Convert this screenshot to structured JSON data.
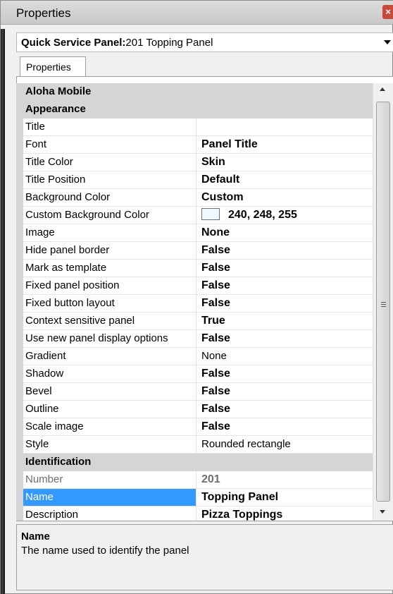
{
  "window": {
    "title": "Properties",
    "close_glyph": "×"
  },
  "selector": {
    "type_label": "Quick Service Panel:",
    "value": "201 Topping Panel"
  },
  "tabs": [
    {
      "label": "Properties"
    }
  ],
  "grid": {
    "categories": {
      "aloha_mobile": "Aloha Mobile",
      "appearance": "Appearance",
      "identification": "Identification"
    },
    "appearance_rows": [
      {
        "name": "Title",
        "value": ""
      },
      {
        "name": "Font",
        "value": "Panel Title"
      },
      {
        "name": "Title Color",
        "value": "Skin"
      },
      {
        "name": "Title Position",
        "value": "Default"
      },
      {
        "name": "Background Color",
        "value": "Custom"
      },
      {
        "name": "Custom Background Color",
        "value": "240, 248, 255"
      },
      {
        "name": "Image",
        "value": "None"
      },
      {
        "name": "Hide panel border",
        "value": "False"
      },
      {
        "name": "Mark as template",
        "value": "False"
      },
      {
        "name": "Fixed panel position",
        "value": "False"
      },
      {
        "name": "Fixed button layout",
        "value": "False"
      },
      {
        "name": "Context sensitive panel",
        "value": "True"
      },
      {
        "name": "Use new panel display options",
        "value": "False"
      },
      {
        "name": "Gradient",
        "value": "None"
      },
      {
        "name": "Shadow",
        "value": "False"
      },
      {
        "name": "Bevel",
        "value": "False"
      },
      {
        "name": "Outline",
        "value": "False"
      },
      {
        "name": "Scale image",
        "value": "False"
      },
      {
        "name": "Style",
        "value": "Rounded rectangle"
      }
    ],
    "identification_rows": [
      {
        "name": "Number",
        "value": "201"
      },
      {
        "name": "Name",
        "value": "Topping Panel"
      },
      {
        "name": "Description",
        "value": "Pizza Toppings"
      }
    ],
    "swatch_color": "#f0f8ff"
  },
  "description": {
    "title": "Name",
    "text": "The name used to identify the panel"
  },
  "colors": {
    "selection": "#3399ff",
    "category_bg": "#d5d5d5"
  }
}
